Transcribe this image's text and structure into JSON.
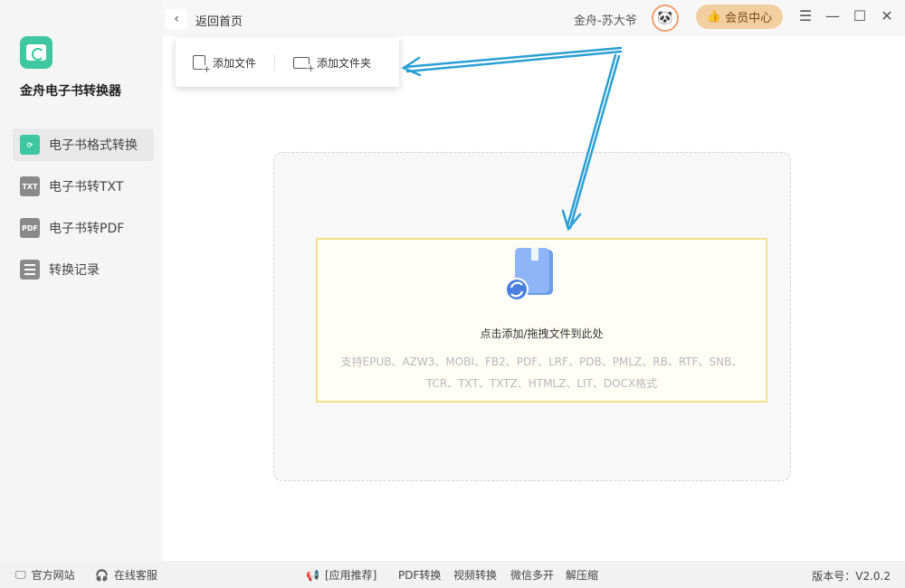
{
  "app": {
    "name": "金舟电子书转换器"
  },
  "sidebar": {
    "items": [
      {
        "label": "电子书格式转换",
        "icon": "convert-icon",
        "icon_text": "",
        "active": true
      },
      {
        "label": "电子书转TXT",
        "icon": "txt-icon",
        "icon_text": "TXT",
        "active": false
      },
      {
        "label": "电子书转PDF",
        "icon": "pdf-icon",
        "icon_text": "PDF",
        "active": false
      },
      {
        "label": "转换记录",
        "icon": "record-icon",
        "icon_text": "",
        "active": false
      }
    ]
  },
  "header": {
    "back_label": "返回首页",
    "username": "金舟-苏大爷",
    "vip_label": "会员中心"
  },
  "dropdown": {
    "add_file": "添加文件",
    "add_folder": "添加文件夹"
  },
  "drop_area": {
    "title": "点击添加/拖拽文件到此处",
    "formats_line1": "支持EPUB、AZW3、MOBI、FB2、PDF、LRF、PDB、PMLZ、RB、RTF、SNB、",
    "formats_line2": "TCR、TXT、TXTZ、HTMLZ、LIT、DOCX格式"
  },
  "footer": {
    "official_site": "官方网站",
    "online_service": "在线客服",
    "app_recommend": "[应用推荐]",
    "links": [
      "PDF转换",
      "视频转换",
      "微信多开",
      "解压缩"
    ],
    "version": "版本号：V2.0.2"
  },
  "colors": {
    "accent": "#3ec7a0",
    "vip": "#f2cfa0",
    "arrow": "#2a9fd6",
    "drop_border": "#f2e08a"
  }
}
